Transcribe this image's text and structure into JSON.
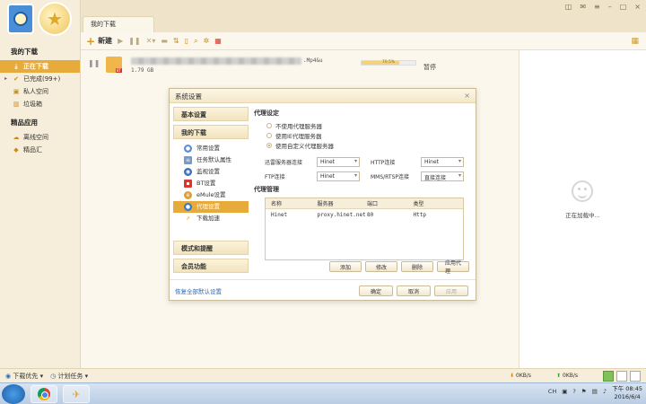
{
  "sidebar": {
    "my_downloads_title": "我的下载",
    "items": [
      {
        "label": "正在下载"
      },
      {
        "label": "已完成(99+)"
      },
      {
        "label": "私人空间"
      },
      {
        "label": "垃圾箱"
      }
    ],
    "apps_title": "精品应用",
    "apps": [
      {
        "label": "离线空间"
      },
      {
        "label": "精品汇"
      }
    ]
  },
  "tab": {
    "label": "我的下载"
  },
  "toolbar": {
    "new_label": "新建"
  },
  "task": {
    "name_suffix": ".Mp4&u",
    "size": "1.79 GB",
    "progress_text": "70.5%",
    "progress": 0.705,
    "status": "暂停"
  },
  "rightpanel": {
    "loading": "正在加载中..."
  },
  "statusbar": {
    "left": [
      {
        "label": "下载优先"
      },
      {
        "label": "计划任务"
      }
    ],
    "down_speed": "0KB/s",
    "up_speed": "0KB/s"
  },
  "taskbar": {
    "tray_lang": "CH",
    "time": "下午 08:45",
    "date": "2016/6/4"
  },
  "dialog": {
    "title": "系统设置",
    "nav": {
      "basic": "基本设置",
      "my_download": "我的下载",
      "items": [
        {
          "label": "常用设置"
        },
        {
          "label": "任务默认属性"
        },
        {
          "label": "监视设置"
        },
        {
          "label": "BT设置"
        },
        {
          "label": "eMule设置"
        },
        {
          "label": "代理设置"
        },
        {
          "label": "下载加速"
        }
      ],
      "mode": "模式和提醒",
      "member": "会员功能"
    },
    "proxy": {
      "title": "代理设定",
      "options": [
        {
          "label": "不使用代理服务器"
        },
        {
          "label": "使用IE代理服务器"
        },
        {
          "label": "使用自定义代理服务器"
        }
      ],
      "rows": [
        {
          "label": "迅雷服务器连接",
          "value": "Hinet"
        },
        {
          "label": "HTTP连接",
          "value": "Hinet"
        },
        {
          "label": "FTP连接",
          "value": "Hinet"
        },
        {
          "label": "MMS/RTSP连接",
          "value": "直接连接"
        }
      ],
      "manage_title": "代理管理",
      "columns": [
        "名称",
        "服务器",
        "端口",
        "类型"
      ],
      "entries": [
        {
          "name": "Hinet",
          "server": "proxy.hinet.net",
          "port": "80",
          "type": "Http"
        }
      ],
      "buttons": [
        "添加",
        "修改",
        "删除",
        "应用代理"
      ]
    },
    "footer": {
      "restore": "恢复全部默认设置",
      "ok": "确定",
      "cancel": "取消",
      "apply": "应用"
    }
  }
}
